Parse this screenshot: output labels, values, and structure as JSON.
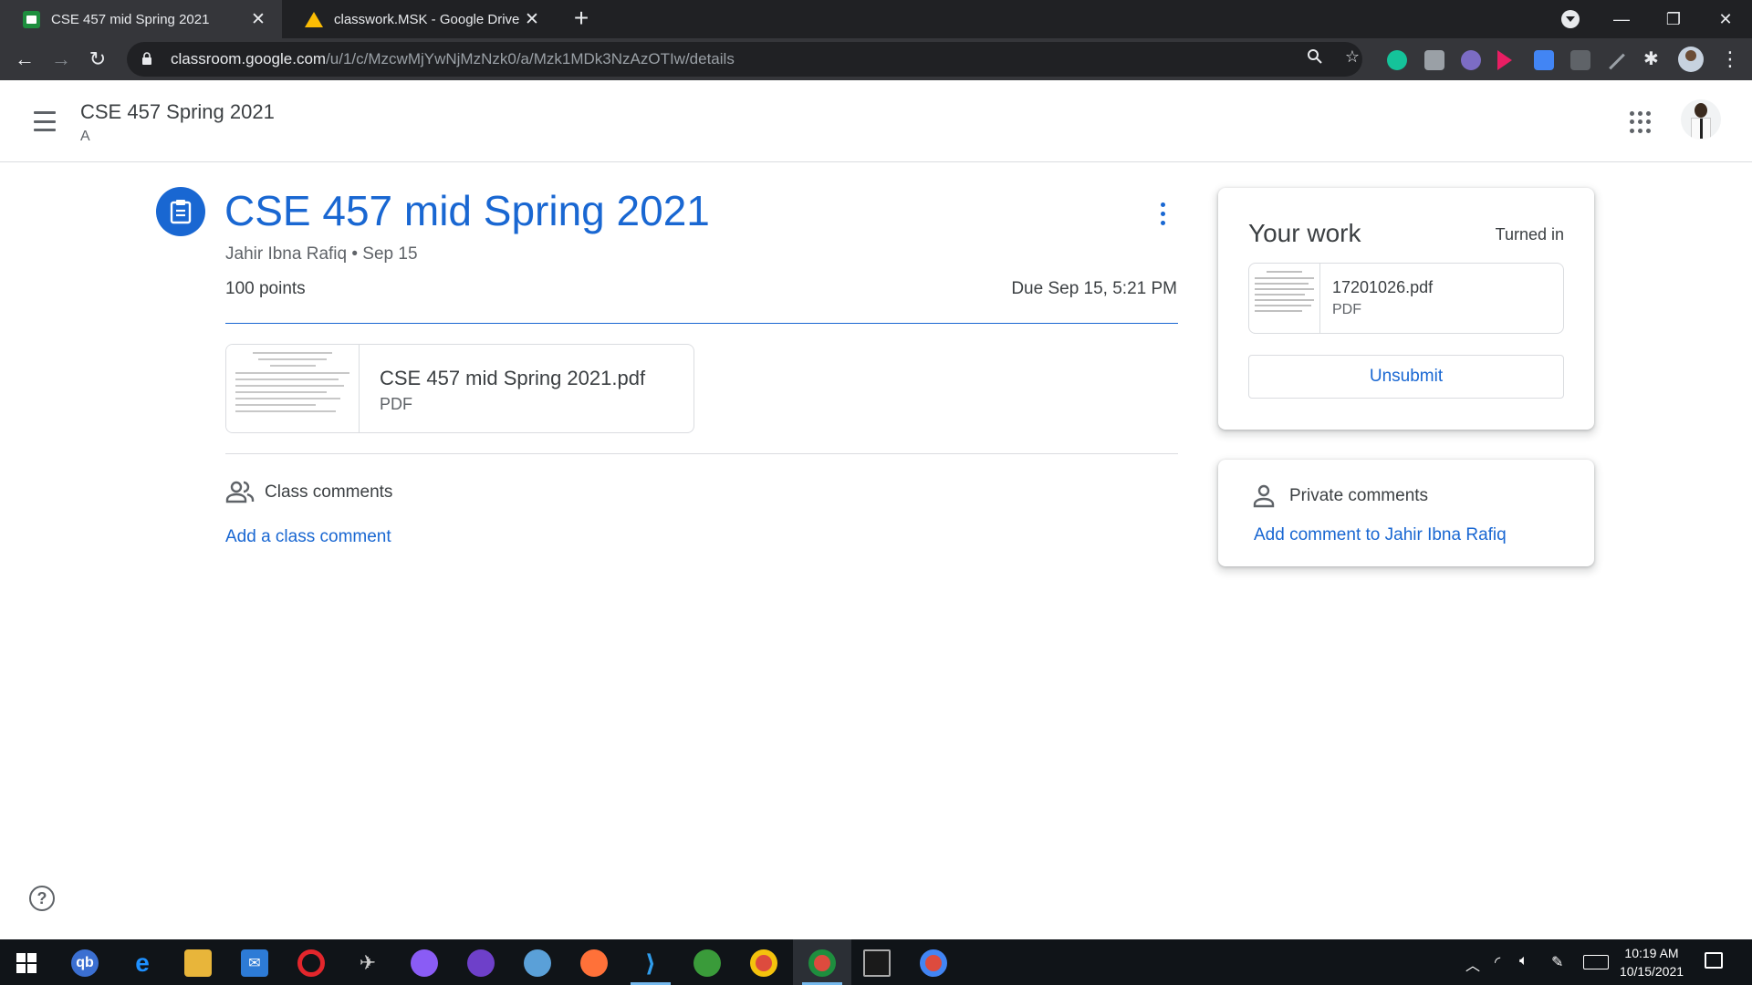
{
  "browser": {
    "tabs": [
      {
        "title": "CSE 457 mid Spring 2021",
        "active": true
      },
      {
        "title": "classwork.MSK - Google Drive",
        "active": false
      }
    ],
    "url_host": "classroom.google.com",
    "url_path": "/u/1/c/MzcwMjYwNjMzNzk0/a/Mzk1MDk3NzAzOTIw/details"
  },
  "header": {
    "class_name": "CSE 457 Spring 2021",
    "section": "A"
  },
  "assignment": {
    "title": "CSE 457 mid Spring 2021",
    "author": "Jahir Ibna Rafiq",
    "posted": "Sep 15",
    "meta_separator": " • ",
    "points": "100 points",
    "due": "Due Sep 15, 5:21 PM",
    "attachment": {
      "name": "CSE 457 mid Spring 2021.pdf",
      "type": "PDF"
    }
  },
  "class_comments": {
    "label": "Class comments",
    "add_link": "Add a class comment"
  },
  "your_work": {
    "title": "Your work",
    "status": "Turned in",
    "file": {
      "name": "17201026.pdf",
      "type": "PDF"
    },
    "unsubmit_label": "Unsubmit"
  },
  "private_comments": {
    "label": "Private comments",
    "add_link": "Add comment to Jahir Ibna Rafiq"
  },
  "taskbar": {
    "time": "10:19 AM",
    "date": "10/15/2021"
  },
  "colors": {
    "accent": "#1967d2",
    "chrome_dark": "#202124",
    "chrome_toolbar": "#35363a",
    "taskbar": "#101418"
  }
}
